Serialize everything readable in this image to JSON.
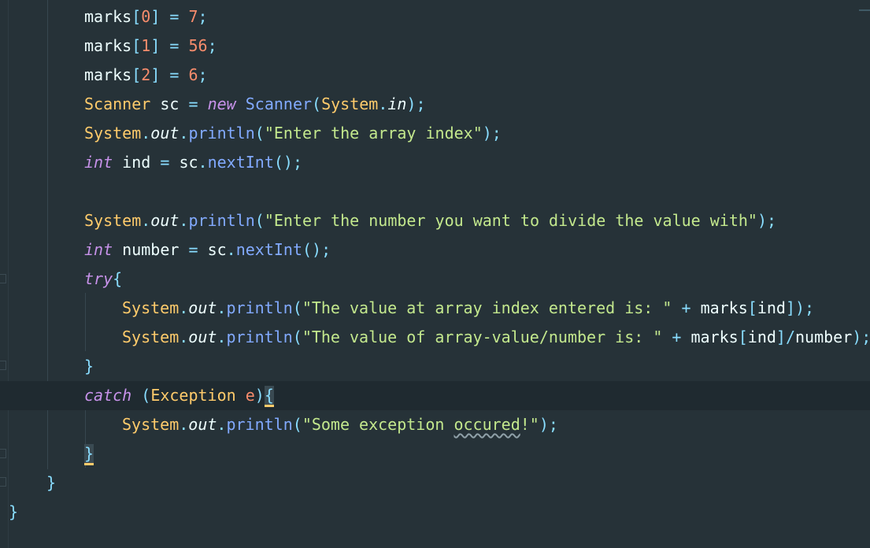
{
  "editor": {
    "language": "java",
    "lines": {
      "l1": {
        "v1": "marks",
        "b1": "[",
        "n": "0",
        "b2": "]",
        "op": "=",
        "num": "7",
        "semi": ";"
      },
      "l2": {
        "v1": "marks",
        "b1": "[",
        "n": "1",
        "b2": "]",
        "op": "=",
        "num": "56",
        "semi": ";"
      },
      "l3": {
        "v1": "marks",
        "b1": "[",
        "n": "2",
        "b2": "]",
        "op": "=",
        "num": "6",
        "semi": ";"
      },
      "l4": {
        "type": "Scanner",
        "var": "sc",
        "op": "=",
        "kw": "new",
        "ctor": "Scanner",
        "p1": "(",
        "sys": "System",
        "dot": ".",
        "field": "in",
        "p2": ");"
      },
      "l5": {
        "sys": "System",
        "dot1": ".",
        "out": "out",
        "dot2": ".",
        "method": "println",
        "p1": "(",
        "str": "\"Enter the array index\"",
        "p2": ");"
      },
      "l6": {
        "kw": "int",
        "var": "ind",
        "op": "=",
        "obj": "sc",
        "dot": ".",
        "method": "nextInt",
        "p": "();"
      },
      "l8": {
        "sys": "System",
        "dot1": ".",
        "out": "out",
        "dot2": ".",
        "method": "println",
        "p1": "(",
        "str": "\"Enter the number you want to divide the value with\"",
        "p2": ");"
      },
      "l9": {
        "kw": "int",
        "var": "number",
        "op": "=",
        "obj": "sc",
        "dot": ".",
        "method": "nextInt",
        "p": "();"
      },
      "l10": {
        "kw": "try",
        "brace": "{"
      },
      "l11": {
        "sys": "System",
        "dot1": ".",
        "out": "out",
        "dot2": ".",
        "method": "println",
        "p1": "(",
        "str": "\"The value at array index entered is: \"",
        "plus": "+",
        "arr": "marks",
        "b1": "[",
        "idx": "ind",
        "b2": "]",
        "p2": ");"
      },
      "l12": {
        "sys": "System",
        "dot1": ".",
        "out": "out",
        "dot2": ".",
        "method": "println",
        "p1": "(",
        "str": "\"The value of array-value/number is: \"",
        "plus": "+",
        "arr": "marks",
        "b1": "[",
        "idx": "ind",
        "b2": "]",
        "div": "/",
        "den": "number",
        "p2": ");"
      },
      "l13": {
        "brace": "}"
      },
      "l14": {
        "kw": "catch",
        "p1": "(",
        "type": "Exception",
        "var": "e",
        "p2": ")",
        "brace": "{"
      },
      "l15": {
        "sys": "System",
        "dot1": ".",
        "out": "out",
        "dot2": ".",
        "method": "println",
        "p1": "(",
        "str_a": "\"Some exception ",
        "str_typo": "occured",
        "str_b": "!\"",
        "p2": ");"
      },
      "l16": {
        "brace": "}"
      },
      "l17": {
        "brace": "}"
      },
      "l18": {
        "brace": "}"
      }
    },
    "colors": {
      "background": "#263238",
      "current_line": "#1f2a30",
      "keyword": "#c792ea",
      "class": "#ffcb6b",
      "method": "#82aaff",
      "string": "#c3e88d",
      "number": "#f78c6c",
      "operator": "#89ddff",
      "identifier": "#eeffff"
    }
  }
}
